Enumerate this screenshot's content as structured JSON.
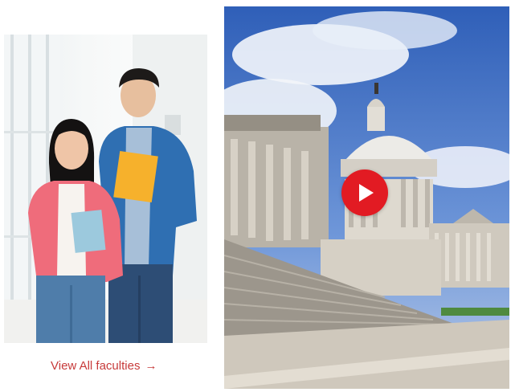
{
  "faculties_link": {
    "label": "View All faculties",
    "arrow": "→",
    "color": "#c73a3a"
  },
  "students_image": {
    "icon": "students-photo"
  },
  "video": {
    "thumbnail": "capitol-building-photo",
    "play_icon": "play-icon",
    "play_color": "#e21b23"
  }
}
